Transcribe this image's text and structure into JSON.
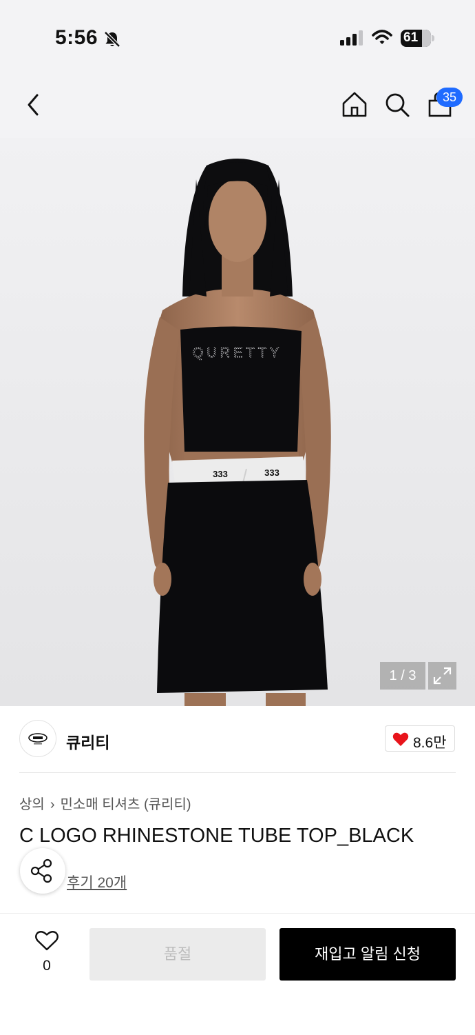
{
  "status_bar": {
    "time": "5:56",
    "battery": "61",
    "icons": [
      "bell-slash-icon",
      "signal-icon",
      "wifi-icon",
      "battery-icon"
    ]
  },
  "header": {
    "back_icon": "chevron-left-icon",
    "home_icon": "home-icon",
    "search_icon": "search-icon",
    "cart_icon": "shopping-bag-icon",
    "cart_count": "35",
    "accent_color": "#1f6bff"
  },
  "hero": {
    "page_indicator": "1 / 3",
    "expand_icon": "expand-icon",
    "image_alt": "Model wearing black strapless tube top with rhinestone logo and black skirt"
  },
  "brand": {
    "name": "큐리티",
    "logo_icon": "brand-logo",
    "like_icon": "heart-filled-icon",
    "like_count": "8.6만",
    "like_color": "#e8141b"
  },
  "product": {
    "breadcrumb": [
      "상의",
      "민소매 티셔츠 (큐리티)"
    ],
    "title": "C LOGO RHINESTONE TUBE TOP_BLACK",
    "review_link": "후기 20개",
    "share_icon": "share-icon"
  },
  "bottom_bar": {
    "wish_icon": "heart-outline-icon",
    "wish_count": "0",
    "soldout_label": "품절",
    "restock_label": "재입고 알림 신청"
  }
}
